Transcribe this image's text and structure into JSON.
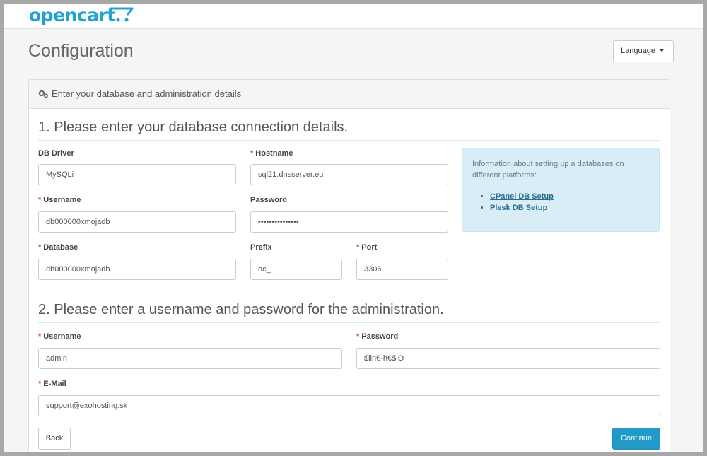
{
  "header": {
    "logo_text": "opencart"
  },
  "page": {
    "title": "Configuration",
    "language_label": "Language"
  },
  "panel": {
    "heading": "Enter your database and administration details"
  },
  "db_section": {
    "title": "1. Please enter your database connection details.",
    "driver": {
      "label": "DB Driver",
      "value": "MySQLi"
    },
    "hostname": {
      "label": "Hostname",
      "value": "sql21.dnsserver.eu"
    },
    "username": {
      "label": "Username",
      "value": "db000000xmojadb"
    },
    "password": {
      "label": "Password",
      "value": "•••••••••••••••"
    },
    "database": {
      "label": "Database",
      "value": "db000000xmojadb"
    },
    "prefix": {
      "label": "Prefix",
      "value": "oc_"
    },
    "port": {
      "label": "Port",
      "value": "3306"
    }
  },
  "info": {
    "text": "Information about setting up a databases on different platforms:",
    "links": [
      "CPanel DB Setup",
      "Plesk DB Setup"
    ]
  },
  "admin_section": {
    "title": "2. Please enter a username and password for the administration.",
    "username": {
      "label": "Username",
      "value": "admin"
    },
    "password": {
      "label": "Password",
      "value": "$iln€-h€$lO"
    },
    "email": {
      "label": "E-Mail",
      "value": "support@exohosting.sk"
    }
  },
  "buttons": {
    "back": "Back",
    "continue": "Continue"
  },
  "required_marker": "*",
  "colors": {
    "brand": "#23a1d1",
    "primary_button": "#229ac8",
    "required": "#d9534f",
    "info_bg": "#d9edf7"
  }
}
